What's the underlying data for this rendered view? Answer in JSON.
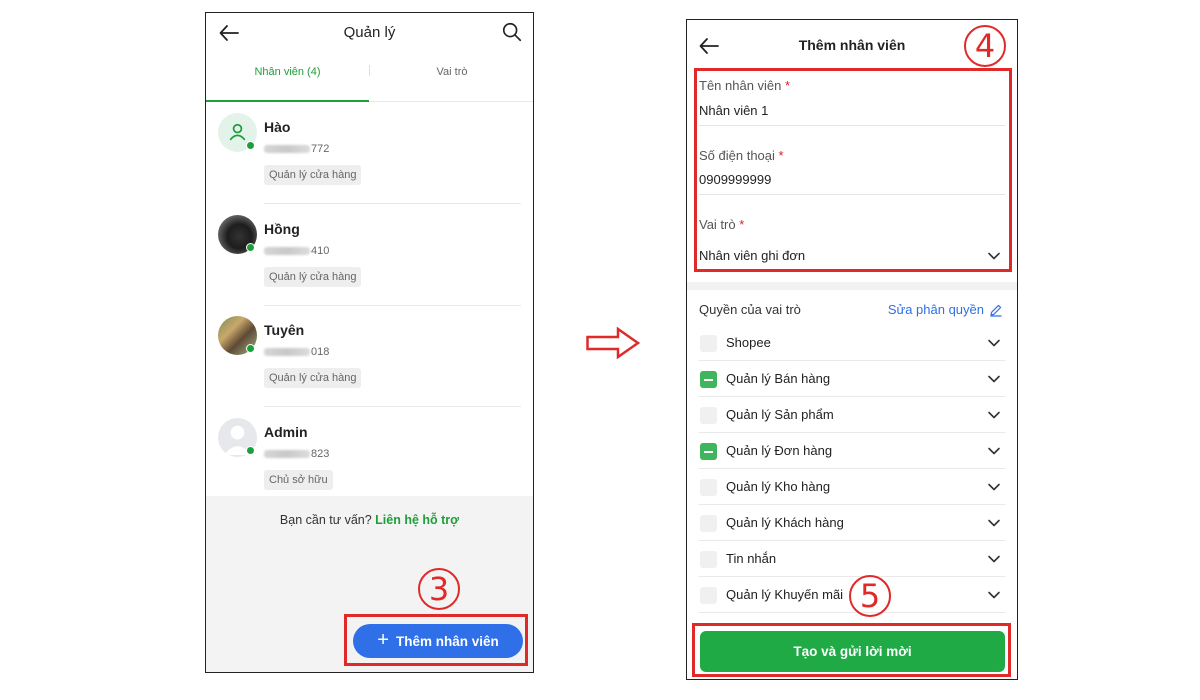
{
  "left_screen": {
    "title": "Quản lý",
    "tabs": [
      {
        "label": "Nhân viên (4)",
        "active": true
      },
      {
        "label": "Vai trò",
        "active": false
      }
    ],
    "staff": [
      {
        "name": "Hào",
        "phone_suffix": "772",
        "role": "Quản lý cửa hàng",
        "online": true
      },
      {
        "name": "Hồng",
        "phone_suffix": "410",
        "role": "Quản lý cửa hàng",
        "online": true
      },
      {
        "name": "Tuyên",
        "phone_suffix": "018",
        "role": "Quản lý cửa hàng",
        "online": true
      },
      {
        "name": "Admin",
        "phone_suffix": "823",
        "role": "Chủ sở hữu",
        "online": true
      }
    ],
    "help_prefix": "Bạn cần tư vấn?",
    "help_link": "Liên hệ hỗ trợ",
    "add_button": "Thêm nhân viên",
    "step_number": "3"
  },
  "right_screen": {
    "title": "Thêm nhân viên",
    "fields": {
      "name_label": "Tên nhân viên",
      "name_value": "Nhân viên 1",
      "phone_label": "Số điện thoại",
      "phone_value": "0909999999",
      "role_label": "Vai trò",
      "role_value": "Nhân viên ghi đơn",
      "required_mark": "*"
    },
    "permissions_header": "Quyền của vai trò",
    "edit_permissions": "Sửa phân quyền",
    "permissions": [
      {
        "label": "Shopee",
        "state": "unchecked"
      },
      {
        "label": "Quản lý Bán hàng",
        "state": "partial"
      },
      {
        "label": "Quản lý Sản phẩm",
        "state": "unchecked"
      },
      {
        "label": "Quản lý Đơn hàng",
        "state": "partial"
      },
      {
        "label": "Quản lý Kho hàng",
        "state": "unchecked"
      },
      {
        "label": "Quản lý Khách hàng",
        "state": "unchecked"
      },
      {
        "label": "Tin nhắn",
        "state": "unchecked"
      },
      {
        "label": "Quản lý Khuyến mãi",
        "state": "unchecked"
      }
    ],
    "submit_button": "Tạo và gửi lời mời",
    "step_numbers": [
      "4",
      "5"
    ]
  },
  "colors": {
    "brand_green": "#1e9e3a",
    "button_blue": "#2f6fe8",
    "annotation_red": "#e02a2a"
  }
}
